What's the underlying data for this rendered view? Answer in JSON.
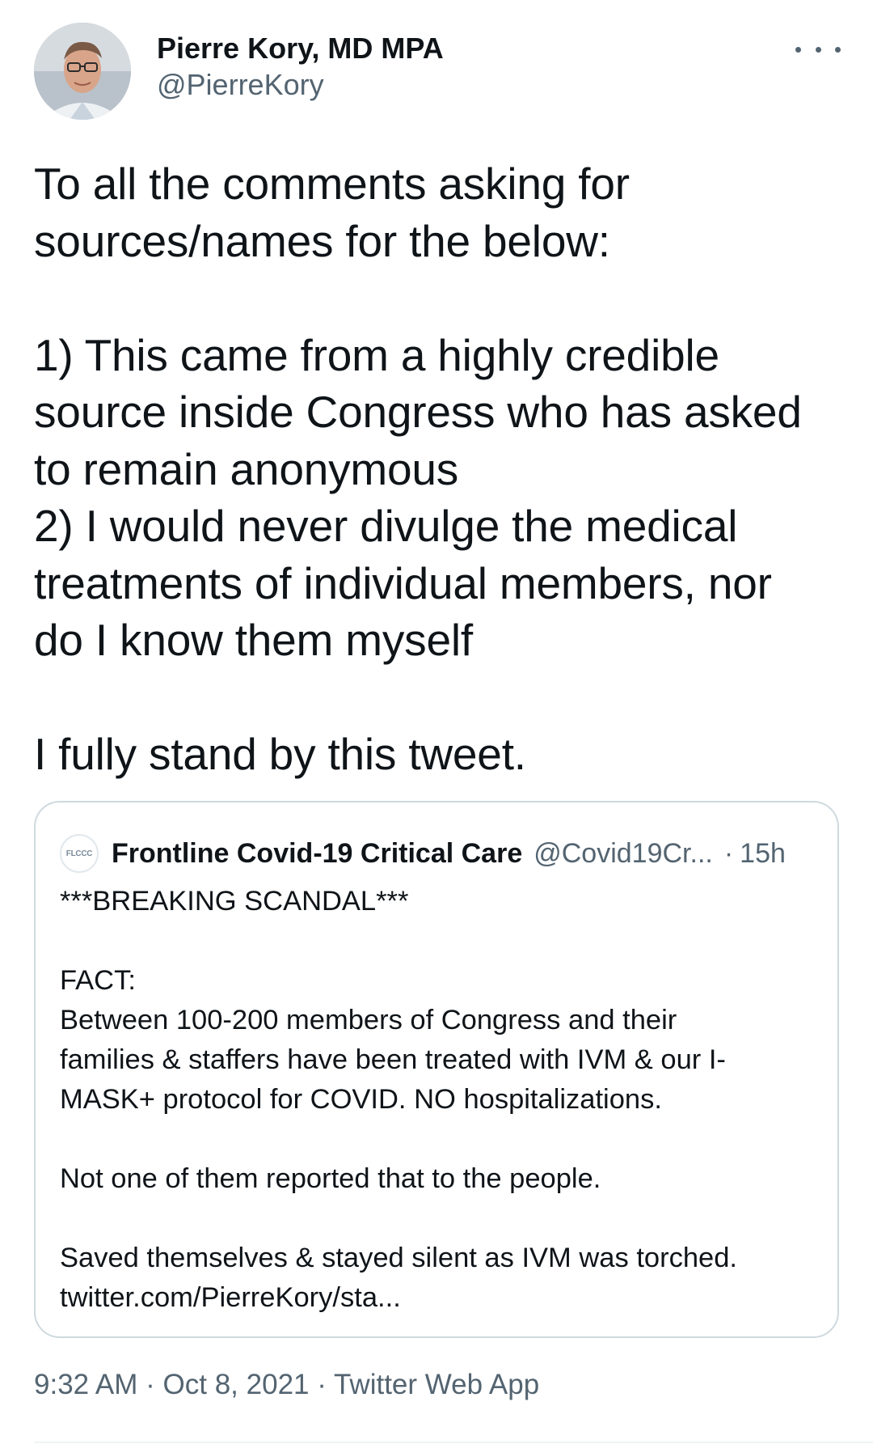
{
  "author": {
    "display_name": "Pierre Kory, MD MPA",
    "handle": "@PierreKory"
  },
  "more_icon": "more-horizontal-icon",
  "tweet": {
    "text": "To all the comments asking for\nsources/names for the below:\n\n1) This came from a highly credible\nsource inside Congress who has asked\nto remain anonymous\n2) I would never divulge the medical\ntreatments of individual members, nor\ndo I know them myself\n\nI fully stand by this tweet."
  },
  "quoted_tweet": {
    "avatar_text": "FLCCC",
    "display_name": "Frontline Covid-19 Critical Care",
    "handle": "@Covid19Cr...",
    "separator": "·",
    "time": "15h",
    "text": "***BREAKING SCANDAL***\n\nFACT:\nBetween 100-200 members of Congress and their\nfamilies & staffers have been treated with IVM & our I-\nMASK+ protocol for COVID. NO hospitalizations.\n\nNot one of them reported that to the people.\n\nSaved themselves & stayed silent as IVM was torched.\ntwitter.com/PierreKory/sta..."
  },
  "meta": {
    "time": "9:32 AM",
    "separator_1": "·",
    "date": "Oct 8, 2021",
    "separator_2": "·",
    "source": "Twitter Web App"
  },
  "colors": {
    "text_primary": "#0f1419",
    "text_secondary": "#536471",
    "border": "#cfd9de"
  }
}
